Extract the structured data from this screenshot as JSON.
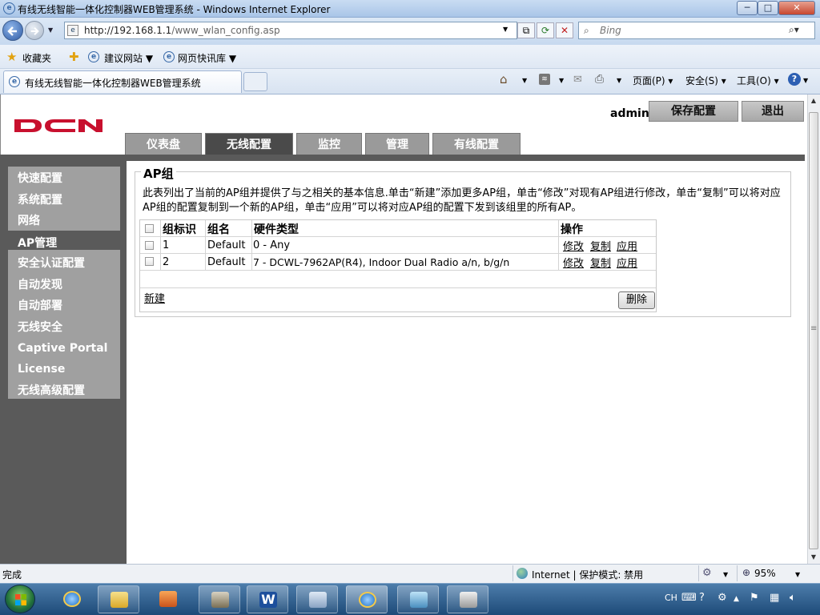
{
  "window": {
    "title": "有线无线智能一体化控制器WEB管理系统 - Windows Internet Explorer",
    "minimize": "─",
    "maximize": "□",
    "close": "✕"
  },
  "address": {
    "host": "http://192.168.1.1",
    "path": "/www_wlan_config.asp",
    "search_placeholder": "Bing"
  },
  "favorites_bar": {
    "favorites": "收藏夹",
    "suggested": "建议网站 ▼",
    "web_slices": "网页快讯库 ▼"
  },
  "tab": {
    "title": "有线无线智能一体化控制器WEB管理系统"
  },
  "command_bar": {
    "page": "页面(P) ▾",
    "safety": "安全(S) ▾",
    "tools": "工具(O) ▾",
    "help": "?"
  },
  "header": {
    "user": "admin",
    "save_config": "保存配置",
    "logout": "退出"
  },
  "nav_tabs": [
    "仪表盘",
    "无线配置",
    "监控",
    "管理",
    "有线配置"
  ],
  "sidebar": {
    "items": [
      "快速配置",
      "系统配置",
      "网络",
      "AP管理",
      "安全认证配置",
      "自动发现",
      "自动部署",
      "无线安全",
      "Captive Portal",
      "License",
      "无线高级配置"
    ],
    "active_index": 3
  },
  "content": {
    "section_title": "AP组",
    "description": "此表列出了当前的AP组并提供了与之相关的基本信息.单击“新建”添加更多AP组，单击“修改”对现有AP组进行修改，单击“复制”可以将对应AP组的配置复制到一个新的AP组，单击“应用”可以将对应AP组的配置下发到该组里的所有AP。",
    "table": {
      "columns": [
        "组标识",
        "组名",
        "硬件类型",
        "操作"
      ],
      "rows": [
        {
          "id": "1",
          "name": "Default",
          "hardware": "0 - Any",
          "actions": [
            "修改",
            "复制",
            "应用"
          ]
        },
        {
          "id": "2",
          "name": "Default",
          "hardware": "7 - DCWL-7962AP(R4), Indoor Dual Radio a/n, b/g/n",
          "actions": [
            "修改",
            "复制",
            "应用"
          ]
        }
      ]
    },
    "new_link": "新建",
    "delete_button": "删除"
  },
  "status_bar": {
    "status": "完成",
    "zone": "Internet | 保护模式: 禁用",
    "zoom": "95%"
  },
  "taskbar": {
    "lang": "CH"
  },
  "colors": {
    "nav_gray": "#9a9a9a",
    "nav_active": "#4a4a4a",
    "sidebar_bg": "#5a5a5a",
    "sidebar_panel": "#a0a0a0",
    "logo_red": "#c8102e"
  }
}
